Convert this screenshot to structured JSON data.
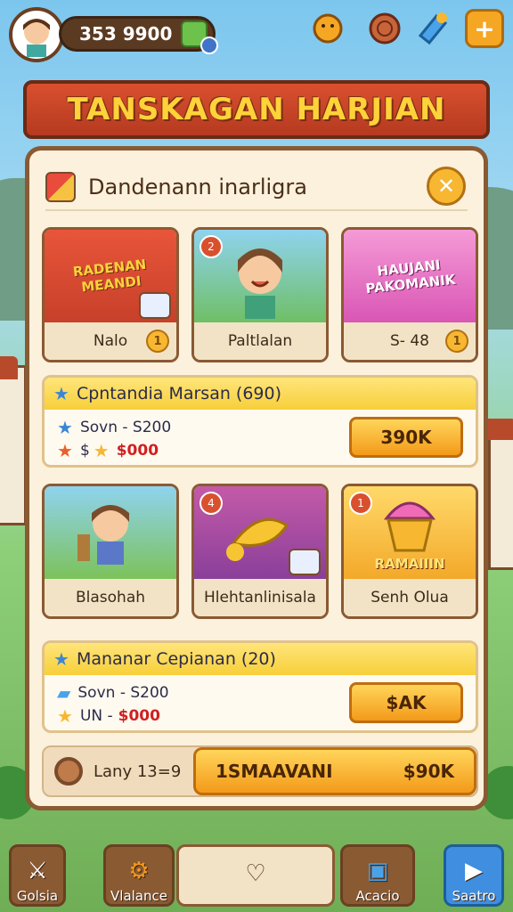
{
  "hud": {
    "currency_value": "353 9900",
    "add_label": "+"
  },
  "banner": {
    "title": "TANSKAGAN HARJIAN"
  },
  "panel": {
    "title": "Dandenann inarligra",
    "close_label": "✕",
    "cards_row1": [
      {
        "art_text": "RADENAN MEANDI",
        "label": "Nalo",
        "coin": "1"
      },
      {
        "art_text": "",
        "label": "Paltlalan",
        "badge": "2"
      },
      {
        "art_text": "HAUJANI PAKOMANIK",
        "label": "S- 48",
        "coin": "1"
      }
    ],
    "offer1": {
      "title": "Cpntandia Marsan (690)",
      "line1": "Sovn - S200",
      "line2_prefix": "$",
      "line2_value": "$000",
      "button": "390K"
    },
    "cards_row2": [
      {
        "art_text": "",
        "label": "Blasohah"
      },
      {
        "art_text": "",
        "label": "Hlehtanlinisala",
        "badge": "4"
      },
      {
        "art_text": "RAMAIIIN",
        "label": "Senh Olua",
        "badge": "1"
      }
    ],
    "offer2": {
      "title": "Mananar Cepianan (20)",
      "line1": "Sovn - S200",
      "line2_prefix": "UN -",
      "line2_value": "$000",
      "button": "$AK"
    },
    "footer": {
      "label": "Lany 13=9",
      "button_left": "1SMAAVANI",
      "button_right": "$90K"
    }
  },
  "nav": [
    {
      "label": "Golsia",
      "icon": "sword-icon"
    },
    {
      "label": "Vlalance",
      "icon": "gear-icon"
    },
    {
      "label": "",
      "icon": "shield-icon"
    },
    {
      "label": "Acacio",
      "icon": "camera-icon"
    },
    {
      "label": "Saatro",
      "icon": "video-icon"
    }
  ],
  "colors": {
    "banner": "#d9502f",
    "banner_text": "#ffd23a",
    "button": "#f39a1a",
    "panel_bg": "#fbf1dc",
    "border": "#8a5a33"
  }
}
